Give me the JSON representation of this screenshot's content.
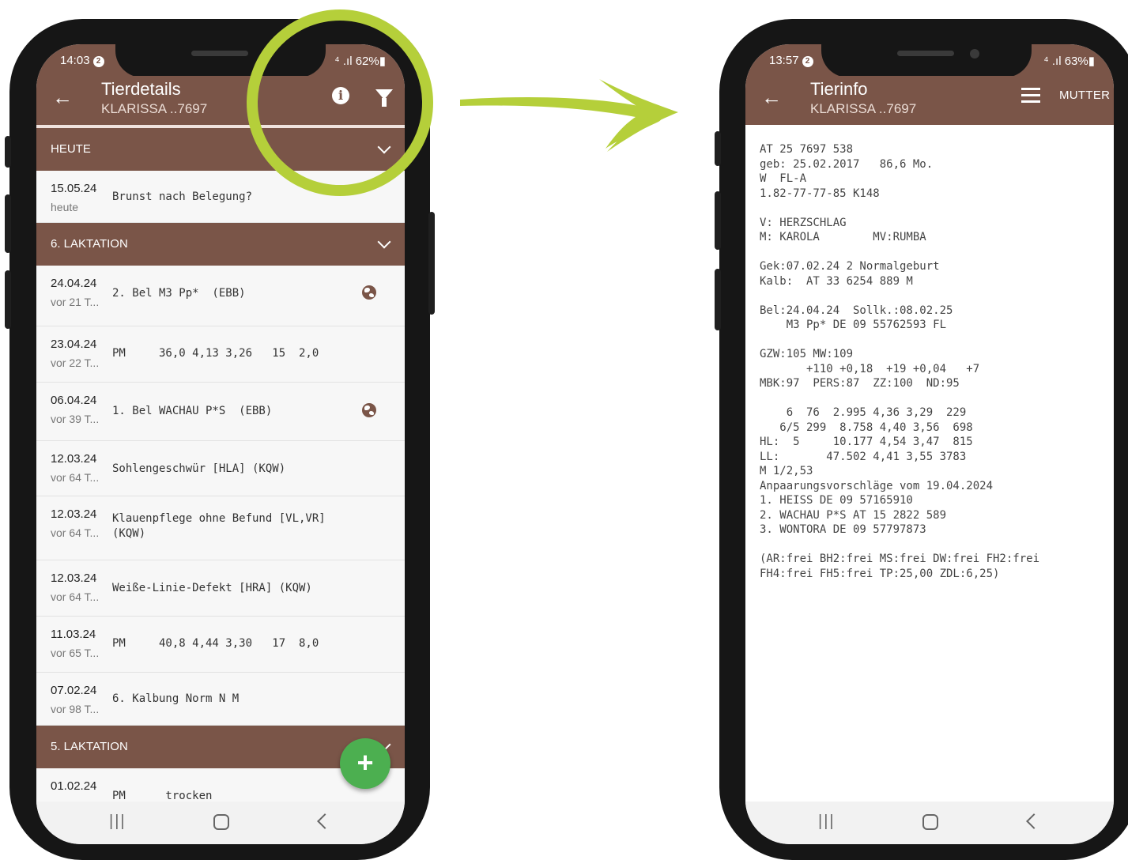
{
  "left_phone": {
    "status": {
      "time": "14:03",
      "notif_count": "2",
      "right": "⁴ .ıl 62%▮"
    },
    "appbar": {
      "back": "←",
      "title": "Tierdetails",
      "subtitle": "KLARISSA ..7697",
      "info_icon": "i"
    },
    "sections": {
      "heute": "HEUTE",
      "laktation6": "6. LAKTATION",
      "laktation5": "5. LAKTATION"
    },
    "rows": [
      {
        "date": "15.05.24",
        "rel": "heute",
        "text": "Brunst nach Belegung?"
      },
      {
        "date": "24.04.24",
        "rel": "vor 21 T...",
        "text": "2. Bel M3 Pp*  (EBB)",
        "globe": true
      },
      {
        "date": "23.04.24",
        "rel": "vor 22 T...",
        "text": "PM     36,0 4,13 3,26   15  2,0"
      },
      {
        "date": "06.04.24",
        "rel": "vor 39 T...",
        "text": "1. Bel WACHAU P*S  (EBB)",
        "globe": true
      },
      {
        "date": "12.03.24",
        "rel": "vor 64 T...",
        "text": "Sohlengeschwür [HLA] (KQW)"
      },
      {
        "date": "12.03.24",
        "rel": "vor 64 T...",
        "text": "Klauenpflege ohne Befund [VL,VR]\n(KQW)"
      },
      {
        "date": "12.03.24",
        "rel": "vor 64 T...",
        "text": "Weiße-Linie-Defekt [HRA] (KQW)"
      },
      {
        "date": "11.03.24",
        "rel": "vor 65 T...",
        "text": "PM     40,8 4,44 3,30   17  8,0"
      },
      {
        "date": "07.02.24",
        "rel": "vor 98 T...",
        "text": "6. Kalbung Norm N M"
      },
      {
        "date": "01.02.24",
        "rel": "",
        "text": "PM      trocken"
      }
    ],
    "fab": "+"
  },
  "right_phone": {
    "status": {
      "time": "13:57",
      "notif_count": "2",
      "right": "⁴ .ıl 63%▮"
    },
    "appbar": {
      "back": "←",
      "title": "Tierinfo",
      "subtitle": "KLARISSA ..7697",
      "mutter": "MUTTER"
    },
    "info_lines": [
      "AT 25 7697 538",
      "geb: 25.02.2017   86,6 Mo.",
      "W  FL-A",
      "1.82-77-77-85 K148",
      "",
      "V: HERZSCHLAG",
      "M: KAROLA        MV:RUMBA",
      "",
      "Gek:07.02.24 2 Normalgeburt",
      "Kalb:  AT 33 6254 889 M",
      "",
      "Bel:24.04.24  Sollk.:08.02.25",
      "    M3 Pp* DE 09 55762593 FL",
      "",
      "GZW:105 MW:109",
      "       +110 +0,18  +19 +0,04   +7",
      "MBK:97  PERS:87  ZZ:100  ND:95",
      "",
      "    6  76  2.995 4,36 3,29  229",
      "   6/5 299  8.758 4,40 3,56  698",
      "HL:  5     10.177 4,54 3,47  815",
      "LL:       47.502 4,41 3,55 3783",
      "M 1/2,53",
      "Anpaarungsvorschläge vom 19.04.2024",
      "1. HEISS DE 09 57165910",
      "2. WACHAU P*S AT 15 2822 589",
      "3. WONTORA DE 09 57797873",
      "",
      "(AR:frei BH2:frei MS:frei DW:frei FH2:frei",
      "FH4:frei FH5:frei TP:25,00 ZDL:6,25)"
    ]
  },
  "navbar": {
    "recents": "|||",
    "back": "<"
  },
  "colors": {
    "appbar": "#7a5548",
    "fab": "#4caf50",
    "annotation": "#b5cf3a",
    "phone": "#161616"
  },
  "icons": [
    "arrow-left-icon",
    "info-icon",
    "filter-icon",
    "list-icon",
    "globe-icon",
    "plus-icon",
    "chevron-down-icon",
    "recents-icon",
    "home-icon",
    "back-nav-icon"
  ]
}
